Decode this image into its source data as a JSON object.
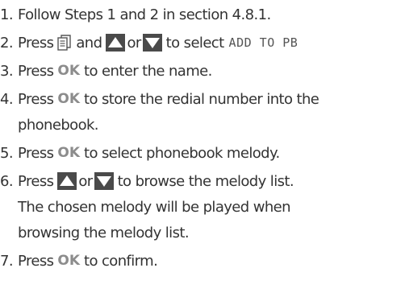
{
  "colors": {
    "text": "#333333",
    "ok_key": "#8c8c8c",
    "arrow_key": "#4a4a4a"
  },
  "icons": {
    "phonebook": "phonebook-key-icon",
    "up": "up-arrow-key-icon",
    "down": "down-arrow-key-icon"
  },
  "ok_key_label": "OK",
  "steps": [
    {
      "number": "1.",
      "text": "Follow Steps 1 and 2 in section 4.8.1."
    },
    {
      "number": "2.",
      "before": "Press",
      "and": "and",
      "or": "or",
      "after": "to select",
      "menu_item": "ADD TO PB"
    },
    {
      "number": "3.",
      "before": "Press",
      "after": "to enter the name."
    },
    {
      "number": "4.",
      "before": "Press",
      "after": "to store the redial number into the",
      "continuation": "phonebook."
    },
    {
      "number": "5.",
      "before": "Press",
      "after": "to select phonebook melody."
    },
    {
      "number": "6.",
      "before": "Press",
      "or": "or",
      "after": "to browse the melody list.",
      "continuation_1": "The chosen melody will be played when",
      "continuation_2": "browsing the melody list."
    },
    {
      "number": "7.",
      "before": "Press",
      "after": "to confirm."
    }
  ]
}
